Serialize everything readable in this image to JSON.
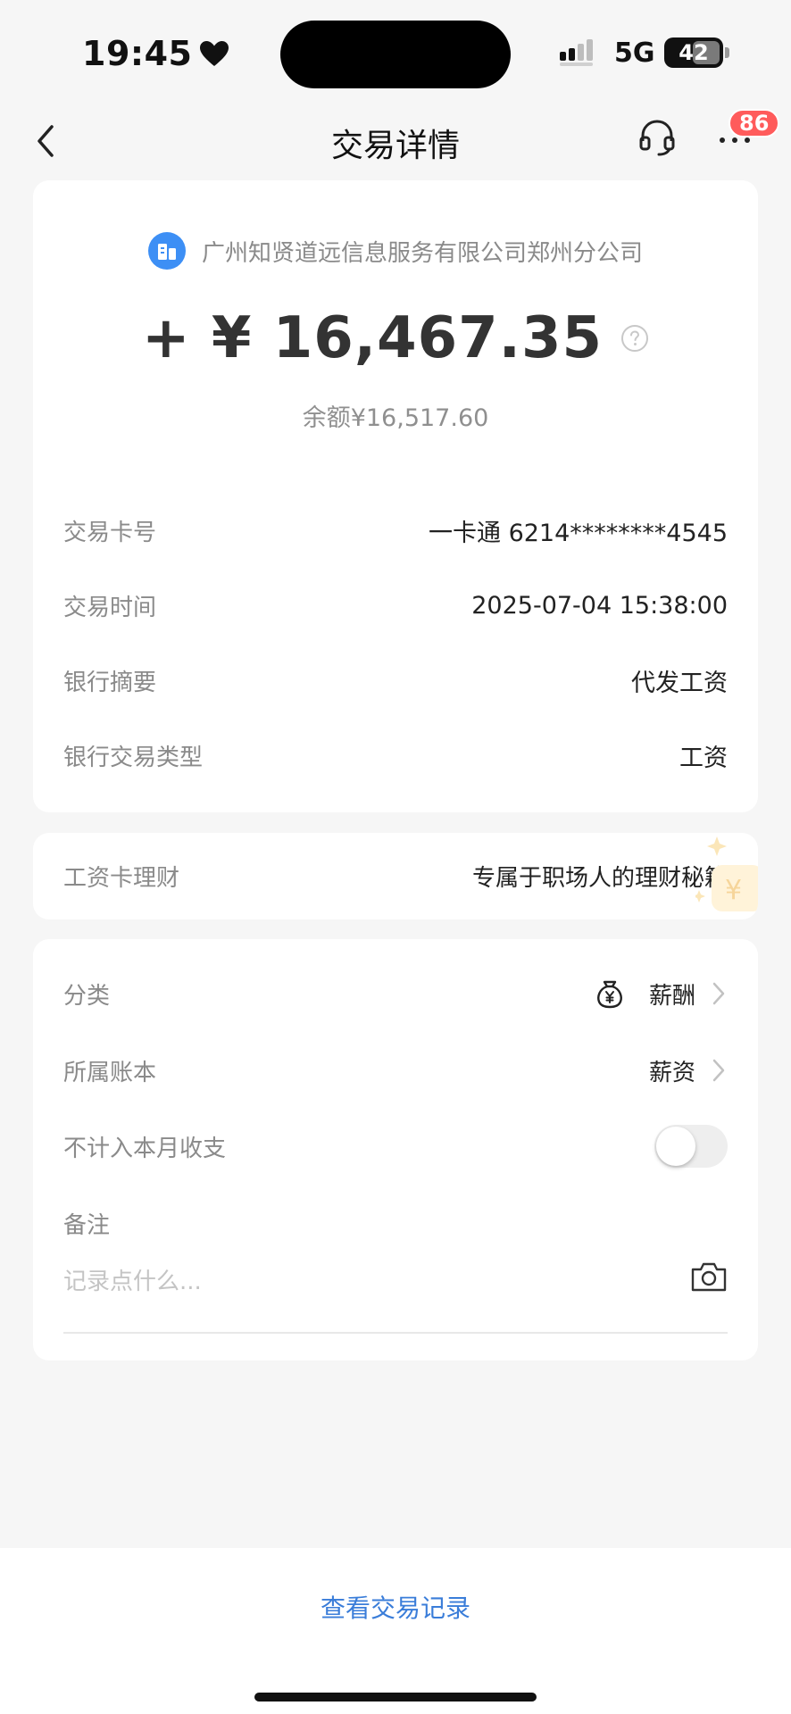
{
  "status_bar": {
    "time": "19:45",
    "network": "5G",
    "battery_level": "42"
  },
  "nav": {
    "title": "交易详情",
    "badge_count": "86"
  },
  "transaction": {
    "merchant": "广州知贤道远信息服务有限公司郑州分公司",
    "amount": "+ ¥ 16,467.35",
    "balance_label": "余额",
    "balance_value": "¥16,517.60",
    "details": [
      {
        "label": "交易卡号",
        "value": "一卡通 6214********4545"
      },
      {
        "label": "交易时间",
        "value": "2025-07-04 15:38:00"
      },
      {
        "label": "银行摘要",
        "value": "代发工资"
      },
      {
        "label": "银行交易类型",
        "value": "工资"
      }
    ]
  },
  "promo": {
    "label": "工资卡理财",
    "value": "专属于职场人的理财秘籍"
  },
  "settings": {
    "category_label": "分类",
    "category_value": "薪酬",
    "book_label": "所属账本",
    "book_value": "薪资",
    "exclude_label": "不计入本月收支",
    "exclude_enabled": false,
    "note_label": "备注",
    "note_placeholder": "记录点什么...",
    "note_value": ""
  },
  "footer": {
    "view_records": "查看交易记录"
  },
  "colors": {
    "accent_link": "#3a7dd9",
    "badge": "#ff5b5b",
    "merchant_icon": "#3d8ff5"
  }
}
